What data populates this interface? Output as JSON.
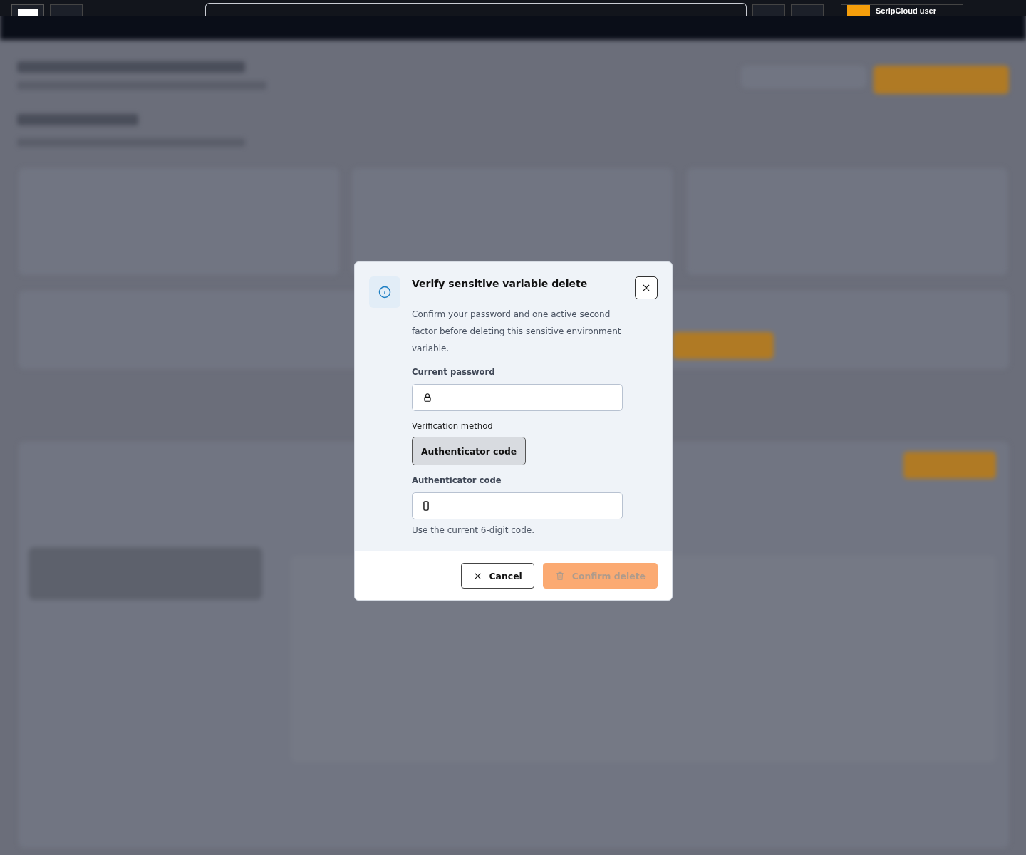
{
  "top_bar": {
    "user_name": "ScripCloud user"
  },
  "dialog": {
    "title": "Verify sensitive variable delete",
    "description": "Confirm your password and one active second factor before deleting this sensitive environment variable.",
    "fields": [
      {
        "label": "Current password",
        "kind": "password"
      },
      {
        "label": "Verification method",
        "kind": "method",
        "options": [
          {
            "label": "Authenticator code",
            "selected": true
          }
        ]
      },
      {
        "label": "Authenticator code",
        "kind": "code",
        "hint": "Use the current 6-digit code."
      }
    ],
    "buttons": [
      {
        "label": "Cancel",
        "kind": "cancel",
        "disabled": false
      },
      {
        "label": "Confirm delete",
        "kind": "delete",
        "disabled": true
      }
    ]
  }
}
